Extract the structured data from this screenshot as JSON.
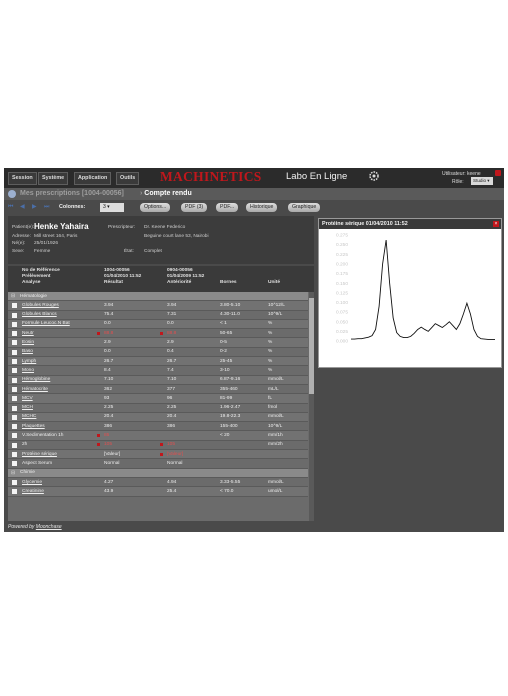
{
  "menu": [
    "Session",
    "Système",
    "Application",
    "Outils"
  ],
  "brand": {
    "name": "MACHINETICS",
    "product": "Labo En Ligne",
    "accent": "#c0171c"
  },
  "user": {
    "label": "Utilisateur:",
    "name": "keene",
    "role_label": "Rôle:",
    "role_value": "Studio"
  },
  "breadcrumb": {
    "parent": "Mes prescriptions [1004-00056]",
    "current": "Compte rendu"
  },
  "toolbar": {
    "columns_label": "Colonnes:",
    "columns_value": "3",
    "buttons": [
      "Options...",
      "PDF (3)",
      "PDF...",
      "Historique",
      "Graphique"
    ]
  },
  "patient": {
    "patient_label": "Patient(e):",
    "patient_name": "Henke Yahaira",
    "address_label": "Adresse:",
    "address_value": "Mill street 164, Paris",
    "born_label": "Né(e):",
    "born_value": "25/01/1926",
    "sex_label": "Sexe:",
    "sex_value": "Femme",
    "prescriber_label": "Prescripteur:",
    "prescriber_value": "Dr. Keene Federico",
    "prescriber_address": "Beguine court lane 53, Nairobi",
    "state_label": "État:",
    "state_value": "Complet"
  },
  "grid": {
    "headers": {
      "c1": [
        "No de Référence",
        "Prélèvement",
        "Analyse"
      ],
      "c2": [
        "1004-00056",
        "01/04/2010 11:52",
        "Résultat"
      ],
      "c3": [
        "0904-00056",
        "01/04/2009 11:52",
        "Antériorité"
      ],
      "c4": "Bornes",
      "c5": "Unité"
    },
    "rows": [
      {
        "type": "section",
        "name": "Hématologie"
      },
      {
        "name": "Globules Rouges",
        "r": "3.94",
        "a": "3.94",
        "b": "3.80-5.10",
        "u": "10^12/L",
        "link": true
      },
      {
        "name": "Globules Blancs",
        "r": "75.4",
        "a": "7.31",
        "b": "4.30-11.0",
        "u": "10^9/L",
        "link": true
      },
      {
        "name": "Formule Leucoc.N Bat",
        "r": "0.0",
        "a": "0.0",
        "b": "< 1",
        "u": "%",
        "link": true
      },
      {
        "name": "Neutr",
        "r": "88.8",
        "a": "88.8",
        "b": "50-65",
        "u": "%",
        "link": true,
        "flag_r": true,
        "flag_a": true
      },
      {
        "name": "Eosin",
        "r": "2.9",
        "a": "2.9",
        "b": "0-5",
        "u": "%",
        "link": true
      },
      {
        "name": "Baso",
        "r": "0.0",
        "a": "0.4",
        "b": "0-2",
        "u": "%",
        "link": true
      },
      {
        "name": "Lymph",
        "r": "26.7",
        "a": "26.7",
        "b": "25-45",
        "u": "%",
        "link": true
      },
      {
        "name": "Mono",
        "r": "8.4",
        "a": "7.4",
        "b": "3-10",
        "u": "%",
        "link": true
      },
      {
        "name": "Hémoglobine",
        "r": "7.10",
        "a": "7.10",
        "b": "6.87-9.16",
        "u": "mmol/L",
        "link": true
      },
      {
        "name": "Hématocrite",
        "r": "362",
        "a": "377",
        "b": "355-460",
        "u": "mL/L",
        "link": true
      },
      {
        "name": "MCV",
        "r": "93",
        "a": "96",
        "b": "81-99",
        "u": "fL",
        "link": true
      },
      {
        "name": "MCH",
        "r": "2.25",
        "a": "2.25",
        "b": "1.96-2.47",
        "u": "fmol",
        "link": true
      },
      {
        "name": "MCHC",
        "r": "20.4",
        "a": "20.4",
        "b": "19.8-22.3",
        "u": "mmol/L",
        "link": true
      },
      {
        "name": "Plaquettes",
        "r": "386",
        "a": "386",
        "b": "155-400",
        "u": "10^9/L",
        "link": true
      },
      {
        "name": "V.Sedimentation 1h",
        "r": "85",
        "a": "",
        "b": "< 20",
        "u": "mm/1h",
        "link": false,
        "flag_r": true
      },
      {
        "name": "2h",
        "r": "105",
        "a": "105",
        "b": "",
        "u": "mm/2h",
        "link": false,
        "flag_r": true,
        "flag_a": true
      },
      {
        "name": "Protéine sérique",
        "r": "[Valeur]",
        "a": "[Valeur]",
        "b": "",
        "u": "",
        "link": true,
        "flag_a": true
      },
      {
        "name": "Aspect Serum",
        "r": "Normal",
        "a": "Normal",
        "b": "",
        "u": "",
        "link": false
      },
      {
        "type": "section",
        "name": "Chimie"
      },
      {
        "name": "Glycemie",
        "r": "4.27",
        "a": "4.94",
        "b": "3.33-5.55",
        "u": "mmol/L",
        "link": true
      },
      {
        "name": "Creatinine",
        "r": "43.9",
        "a": "25.4",
        "b": "< 70.0",
        "u": "umol/L",
        "link": true
      }
    ]
  },
  "panel": {
    "title": "Protéine sérique 01/04/2010 11:52"
  },
  "chart_data": {
    "type": "line",
    "title": "Protéine sérique 01/04/2010 11:52",
    "yticks": [
      "0.275",
      "0.250",
      "0.225",
      "0.200",
      "0.175",
      "0.150",
      "0.125",
      "0.100",
      "0.075",
      "0.050",
      "0.025",
      "0.000"
    ],
    "ylim": [
      0,
      0.275
    ],
    "y": [
      0.005,
      0.005,
      0.006,
      0.006,
      0.008,
      0.01,
      0.014,
      0.03,
      0.09,
      0.2,
      0.262,
      0.15,
      0.06,
      0.022,
      0.012,
      0.009,
      0.009,
      0.012,
      0.02,
      0.03,
      0.036,
      0.03,
      0.025,
      0.035,
      0.045,
      0.04,
      0.035,
      0.042,
      0.05,
      0.04,
      0.03,
      0.045,
      0.07,
      0.098,
      0.07,
      0.03,
      0.012,
      0.006,
      0.005,
      0.004,
      0.004,
      0.004
    ]
  },
  "footer": {
    "prefix": "Powered by",
    "link": "Moonchase"
  }
}
